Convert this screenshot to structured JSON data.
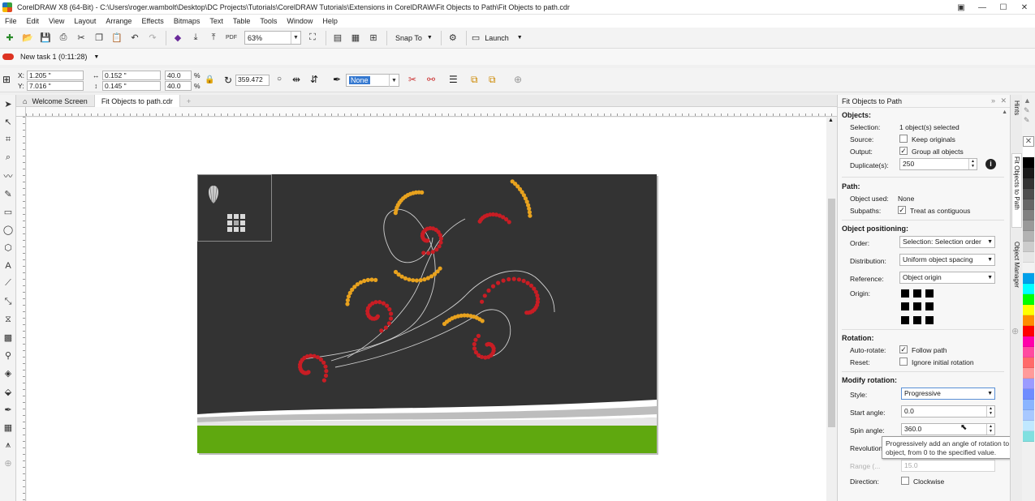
{
  "window": {
    "title": "CorelDRAW X8 (64-Bit) - C:\\Users\\roger.wambolt\\Desktop\\DC Projects\\Tutorials\\CorelDRAW Tutorials\\Extensions in CorelDRAW\\Fit Objects to Path\\Fit Objects to path.cdr"
  },
  "menu": [
    "File",
    "Edit",
    "View",
    "Layout",
    "Arrange",
    "Effects",
    "Bitmaps",
    "Text",
    "Table",
    "Tools",
    "Window",
    "Help"
  ],
  "toolbar": {
    "zoom": "63%",
    "snap_to": "Snap To",
    "launch": "Launch"
  },
  "task": {
    "label": "New task 1 (0:11:28)"
  },
  "property_bar": {
    "x_label": "X:",
    "x_value": "1.205 \"",
    "y_label": "Y:",
    "y_value": "7.016 \"",
    "w_value": "0.152 \"",
    "h_value": "0.145 \"",
    "scale_w": "40.0",
    "scale_h": "40.0",
    "percent": "%",
    "rotation": "359.472",
    "outline": "None"
  },
  "tabs": [
    "Welcome Screen",
    "Fit Objects to path.cdr"
  ],
  "docker": {
    "title": "Fit Objects to Path",
    "objects": {
      "heading": "Objects:",
      "selection_label": "Selection:",
      "selection_value": "1 object(s) selected",
      "source_label": "Source:",
      "keep_originals": "Keep originals",
      "output_label": "Output:",
      "group_all": "Group all objects",
      "duplicates_label": "Duplicate(s):",
      "duplicates_value": "250"
    },
    "path": {
      "heading": "Path:",
      "object_used_label": "Object used:",
      "object_used_value": "None",
      "subpaths_label": "Subpaths:",
      "contiguous": "Treat as contiguous"
    },
    "positioning": {
      "heading": "Object positioning:",
      "order_label": "Order:",
      "order_value": "Selection: Selection order",
      "distribution_label": "Distribution:",
      "distribution_value": "Uniform object spacing",
      "reference_label": "Reference:",
      "reference_value": "Object origin",
      "origin_label": "Origin:"
    },
    "rotation": {
      "heading": "Rotation:",
      "auto_rotate_label": "Auto-rotate:",
      "follow_path": "Follow path",
      "reset_label": "Reset:",
      "ignore_initial": "Ignore initial rotation"
    },
    "modify_rotation": {
      "heading": "Modify rotation:",
      "style_label": "Style:",
      "style_value": "Progressive",
      "start_angle_label": "Start angle:",
      "start_angle_value": "0.0",
      "spin_angle_label": "Spin angle:",
      "spin_angle_value": "360.0",
      "revolutions_label": "Revolution",
      "range_label": "Range (...",
      "range_value": "15.0",
      "direction_label": "Direction:",
      "clockwise": "Clockwise"
    },
    "tooltip": "Progressively add an angle of rotation to each object, from 0 to the specified value."
  },
  "side_tabs": [
    "Hints",
    "Fit Objects to Path",
    "Object Manager"
  ],
  "palette": [
    "#ffffff",
    "#000000",
    "#1a1a1a",
    "#333333",
    "#4d4d4d",
    "#666666",
    "#808080",
    "#999999",
    "#b3b3b3",
    "#cccccc",
    "#e6e6e6",
    "#f2f2f2",
    "#00a0e9",
    "#00ffff",
    "#00ff00",
    "#ffff00",
    "#ff8c00",
    "#ff0000",
    "#ff00aa",
    "#ff4aa0",
    "#ff6a6a",
    "#ff9a9a",
    "#9b9bff",
    "#6f8cff",
    "#8ab4ff",
    "#a8c8ff",
    "#c0e8ff",
    "#80e0e0"
  ],
  "colors": {
    "artboard": "#333333",
    "bead_red": "#c81d24",
    "bead_gold": "#e8a21e",
    "ground": "#5fa80f"
  }
}
